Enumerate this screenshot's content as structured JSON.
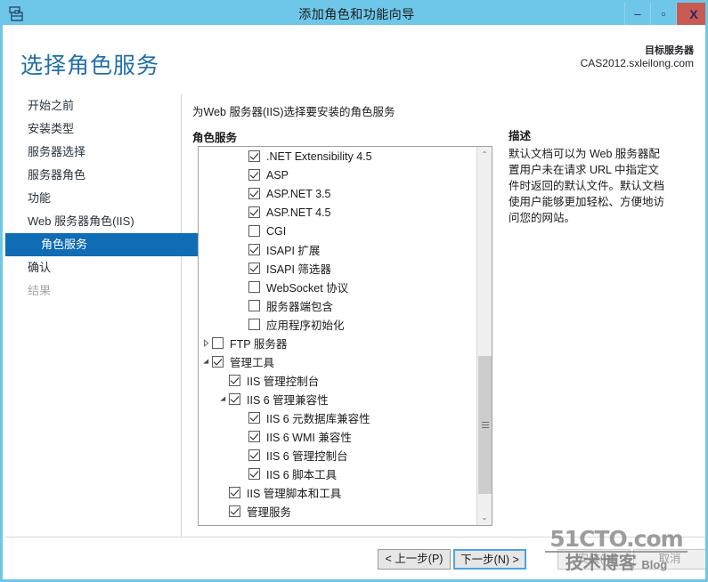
{
  "window": {
    "title": "添加角色和功能向导",
    "icon": "server-toolbox-icon",
    "minimize_label": "–",
    "maximize_label": "▫",
    "close_label": "X",
    "accent_color": "#6ec7e8",
    "close_color": "#c75b52"
  },
  "header": {
    "page_title": "选择角色服务",
    "target_server_label": "目标服务器",
    "target_server_name": "CAS2012.sxleilong.com",
    "title_color": "#1f6fa8"
  },
  "sidebar": {
    "selected_color": "#0f6cb5",
    "items": [
      {
        "label": "开始之前",
        "state": "normal",
        "level": 0
      },
      {
        "label": "安装类型",
        "state": "normal",
        "level": 0
      },
      {
        "label": "服务器选择",
        "state": "normal",
        "level": 0
      },
      {
        "label": "服务器角色",
        "state": "normal",
        "level": 0
      },
      {
        "label": "功能",
        "state": "normal",
        "level": 0
      },
      {
        "label": "Web 服务器角色(IIS)",
        "state": "normal",
        "level": 0
      },
      {
        "label": "角色服务",
        "state": "selected",
        "level": 1
      },
      {
        "label": "确认",
        "state": "normal",
        "level": 0
      },
      {
        "label": "结果",
        "state": "disabled",
        "level": 0
      }
    ]
  },
  "main": {
    "instruction": "为Web 服务器(IIS)选择要安装的角色服务",
    "roleservices_label": "角色服务",
    "tree": [
      {
        "label": ".NET Extensibility 4.5",
        "checked": true,
        "level": 2,
        "expander": ""
      },
      {
        "label": "ASP",
        "checked": true,
        "level": 2,
        "expander": ""
      },
      {
        "label": "ASP.NET 3.5",
        "checked": true,
        "level": 2,
        "expander": ""
      },
      {
        "label": "ASP.NET 4.5",
        "checked": true,
        "level": 2,
        "expander": ""
      },
      {
        "label": "CGI",
        "checked": false,
        "level": 2,
        "expander": ""
      },
      {
        "label": "ISAPI 扩展",
        "checked": true,
        "level": 2,
        "expander": ""
      },
      {
        "label": "ISAPI 筛选器",
        "checked": true,
        "level": 2,
        "expander": ""
      },
      {
        "label": "WebSocket 协议",
        "checked": false,
        "level": 2,
        "expander": ""
      },
      {
        "label": "服务器端包含",
        "checked": false,
        "level": 2,
        "expander": ""
      },
      {
        "label": "应用程序初始化",
        "checked": false,
        "level": 2,
        "expander": ""
      },
      {
        "label": "FTP 服务器",
        "checked": false,
        "level": 0,
        "expander": "collapsed"
      },
      {
        "label": "管理工具",
        "checked": true,
        "level": 0,
        "expander": "expanded"
      },
      {
        "label": "IIS 管理控制台",
        "checked": true,
        "level": 1,
        "expander": ""
      },
      {
        "label": "IIS 6 管理兼容性",
        "checked": true,
        "level": 1,
        "expander": "expanded"
      },
      {
        "label": "IIS 6 元数据库兼容性",
        "checked": true,
        "level": 2,
        "expander": ""
      },
      {
        "label": "IIS 6 WMI 兼容性",
        "checked": true,
        "level": 2,
        "expander": ""
      },
      {
        "label": "IIS 6 管理控制台",
        "checked": true,
        "level": 2,
        "expander": ""
      },
      {
        "label": "IIS 6 脚本工具",
        "checked": true,
        "level": 2,
        "expander": ""
      },
      {
        "label": "IIS 管理脚本和工具",
        "checked": true,
        "level": 1,
        "expander": ""
      },
      {
        "label": "管理服务",
        "checked": true,
        "level": 1,
        "expander": ""
      }
    ],
    "scrollbar": {
      "up_arrow": "⌃",
      "down_arrow": "⌄"
    }
  },
  "description": {
    "title": "描述",
    "body": "默认文档可以为 Web 服务器配置用户未在请求 URL 中指定文件时返回的默认文件。默认文档使用户能够更加轻松、方便地访问您的网站。"
  },
  "footer": {
    "previous_label": "< 上一步(P)",
    "next_label": "下一步(N) >",
    "install_label": "安装(I)",
    "cancel_label": "取消",
    "next_focus_color": "#4ea3e0"
  },
  "watermark": {
    "top": "51CTO.com",
    "bottom_cn": "技术博客",
    "bottom_en": "Blog"
  }
}
